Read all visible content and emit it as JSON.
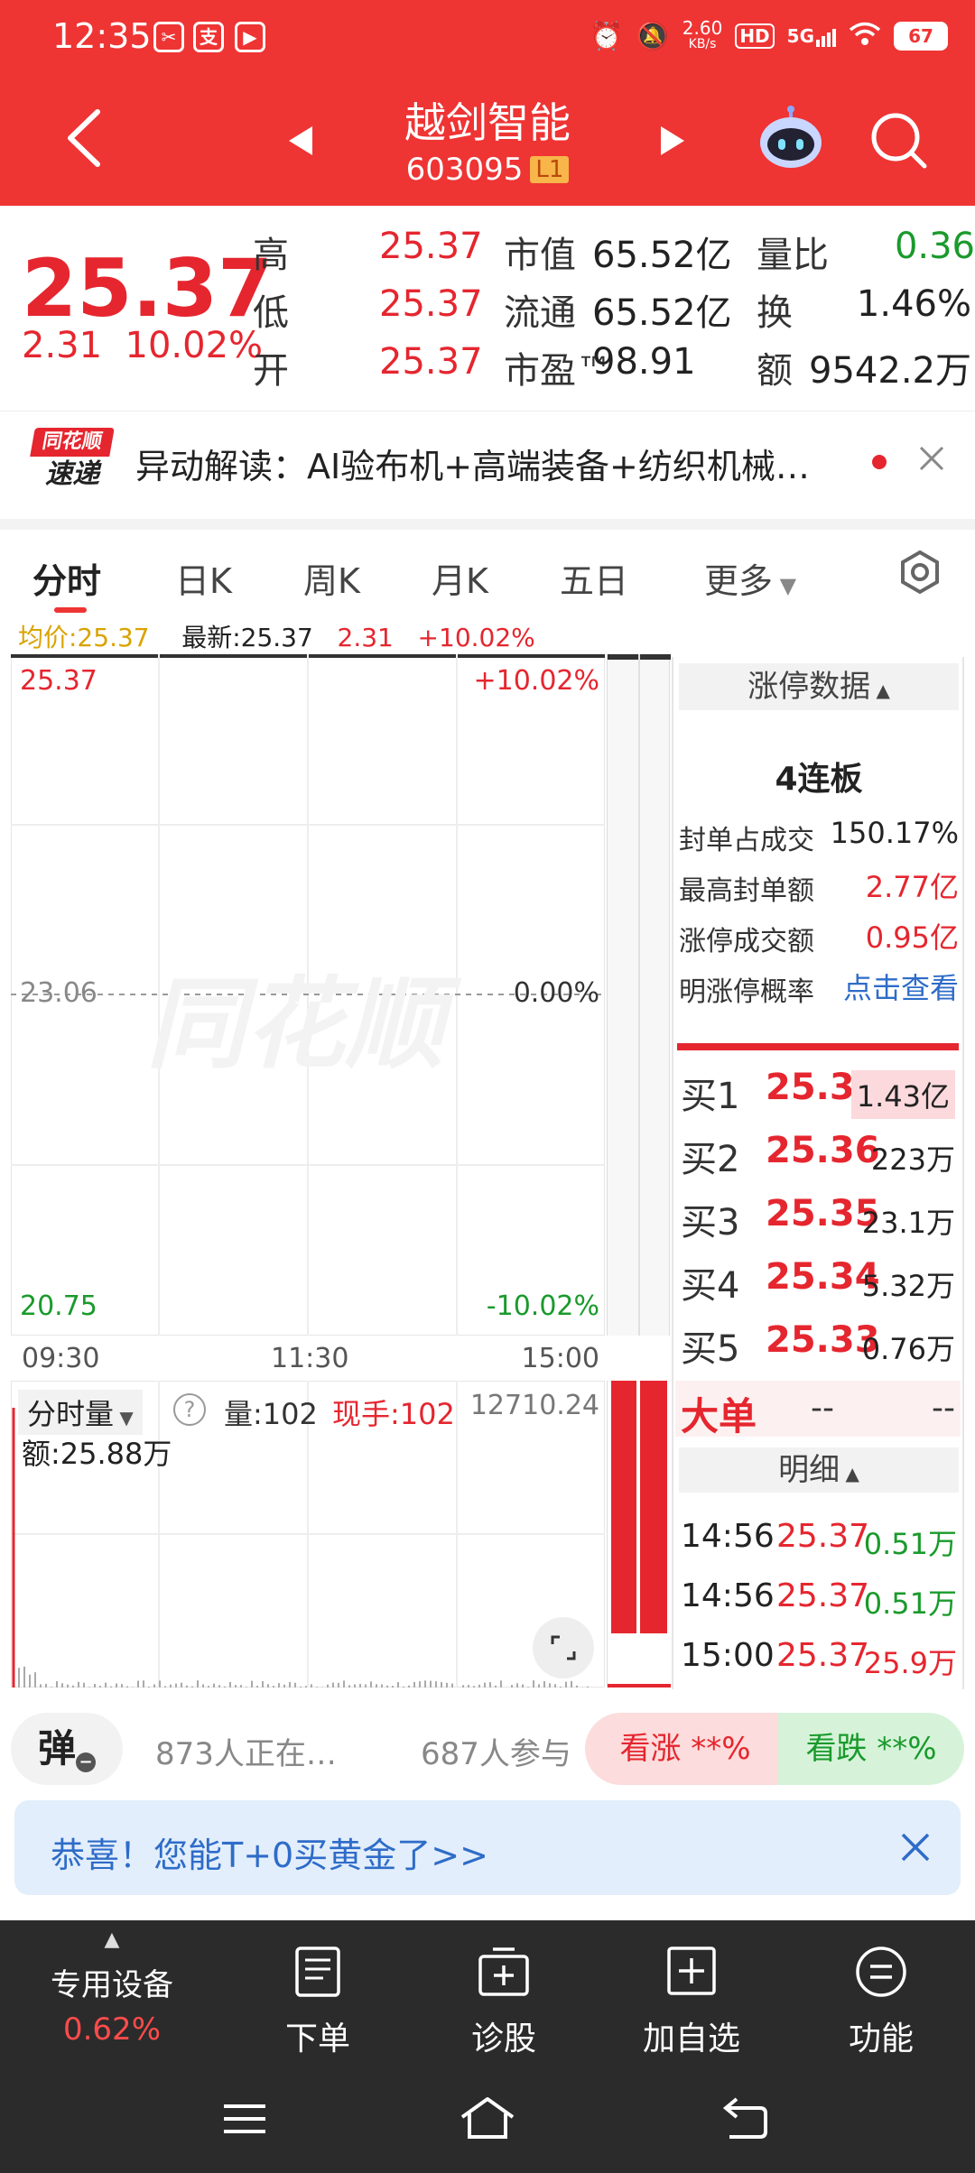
{
  "status": {
    "time": "12:35",
    "speed": "2.60",
    "speed_unit": "KB/s",
    "hd": "HD",
    "network": "5G",
    "battery": "67"
  },
  "stock": {
    "name": "越剑智能",
    "code": "603095",
    "level": "L1",
    "price": "25.37",
    "change": "2.31",
    "change_pct": "10.02%"
  },
  "quote": {
    "rows": [
      {
        "l1": "高",
        "v1": "25.37",
        "l2": "市值",
        "v2": "65.52亿",
        "l3": "量比",
        "v3": "0.36"
      },
      {
        "l1": "低",
        "v1": "25.37",
        "l2": "流通",
        "v2": "65.52亿",
        "l3": "换",
        "v3": "1.46%"
      },
      {
        "l1": "开",
        "v1": "25.37",
        "l2": "市盈™",
        "v2": "98.91",
        "l3": "额",
        "v3": "9542.2万"
      }
    ]
  },
  "news": {
    "logo_top": "同花顺",
    "logo_bottom": "速递",
    "text": "异动解读：AI验布机+高端装备+纺织机械…"
  },
  "tabs": [
    "分时",
    "日K",
    "周K",
    "月K",
    "五日",
    "更多"
  ],
  "avg_row": {
    "avg": "均价:25.37",
    "latest": "最新:25.37",
    "chg": "2.31",
    "pct": "+10.02%"
  },
  "chart": {
    "top_price": "25.37",
    "top_pct": "+10.02%",
    "mid_price": "23.06",
    "mid_pct": "0.00%",
    "bottom_price": "20.75",
    "bottom_pct": "-10.02%",
    "watermark": "同花顺",
    "times": [
      "09:30",
      "11:30",
      "15:00"
    ]
  },
  "volume": {
    "dropdown": "分时量",
    "help": "?",
    "vol": "量:102",
    "current": "现手:102",
    "max": "12710.24",
    "amount": "额:25.88万"
  },
  "limit_panel": {
    "header": "涨停数据",
    "streak": "4连板",
    "items": [
      {
        "label": "封单占成交",
        "value": "150.17%"
      },
      {
        "label": "最高封单额",
        "value": "2.77亿"
      },
      {
        "label": "涨停成交额",
        "value": "0.95亿"
      },
      {
        "label": "明涨停概率",
        "value": "点击查看"
      }
    ]
  },
  "bids": [
    {
      "label": "买1",
      "price": "25.37",
      "vol": "1.43亿"
    },
    {
      "label": "买2",
      "price": "25.36",
      "vol": "223万"
    },
    {
      "label": "买3",
      "price": "25.35",
      "vol": "23.1万"
    },
    {
      "label": "买4",
      "price": "25.34",
      "vol": "5.32万"
    },
    {
      "label": "买5",
      "price": "25.33",
      "vol": "0.76万"
    }
  ],
  "big_order": {
    "label": "大单",
    "v1": "--",
    "v2": "--"
  },
  "detail": {
    "header": "明细",
    "rows": [
      {
        "time": "14:56",
        "price": "25.37",
        "vol": "0.51万"
      },
      {
        "time": "14:56",
        "price": "25.37",
        "vol": "0.51万"
      },
      {
        "time": "15:00",
        "price": "25.37",
        "vol": "25.9万"
      }
    ]
  },
  "vote": {
    "danmu": "弹",
    "online": "873人正在…",
    "participants": "687人参与",
    "up": "看涨 **%",
    "down": "看跌 **%"
  },
  "banner": {
    "text": "恭喜！您能T+0买黄金了>>"
  },
  "bottom_nav": {
    "special": "专用设备",
    "special_pct": "0.62%",
    "items": [
      "下单",
      "诊股",
      "加自选",
      "功能"
    ]
  }
}
